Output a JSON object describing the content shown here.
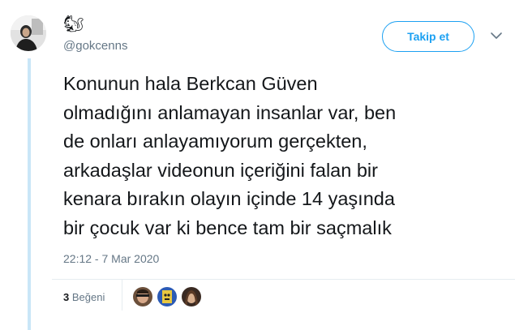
{
  "user": {
    "display_emoji": "🐿",
    "handle": "@gokcenns"
  },
  "follow_button": {
    "label": "Takip et"
  },
  "tweet": {
    "lines": [
      "Konunun hala Berkcan Güven",
      "olmadığını anlamayan insanlar var, ben",
      "de onları anlayamıyorum gerçekten,",
      "arkadaşlar videonun içeriğini falan bir",
      "kenara bırakın olayın içinde 14 yaşında",
      "bir çocuk var ki bence tam bir saçmalık"
    ],
    "timestamp": "22:12 - 7 Mar 2020"
  },
  "likes": {
    "count": "3",
    "label": "Beğeni"
  },
  "colors": {
    "accent": "#1da1f2",
    "muted": "#657786",
    "thread": "#c9e6f7"
  }
}
